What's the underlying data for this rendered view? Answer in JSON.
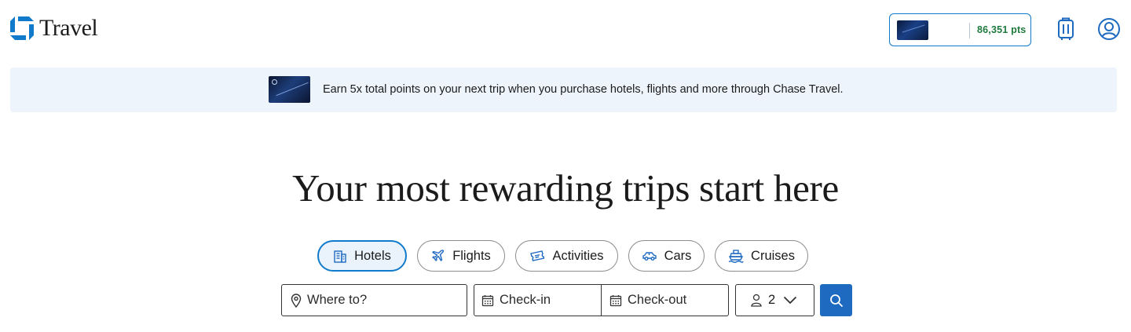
{
  "header": {
    "logo_text": "Travel",
    "points": "86,351 pts"
  },
  "banner": {
    "text": "Earn 5x total points on your next trip when you purchase hotels, flights and more through Chase Travel."
  },
  "headline": "Your most rewarding trips start here",
  "tabs": [
    {
      "label": "Hotels",
      "icon": "building-icon",
      "selected": true
    },
    {
      "label": "Flights",
      "icon": "airplane-icon",
      "selected": false
    },
    {
      "label": "Activities",
      "icon": "ticket-icon",
      "selected": false
    },
    {
      "label": "Cars",
      "icon": "car-icon",
      "selected": false
    },
    {
      "label": "Cruises",
      "icon": "ship-icon",
      "selected": false
    }
  ],
  "search": {
    "destination_placeholder": "Where to?",
    "checkin_placeholder": "Check-in",
    "checkout_placeholder": "Check-out",
    "guests": "2"
  },
  "colors": {
    "brand_blue": "#117aca",
    "search_button": "#1f6ac1",
    "banner_bg": "#edf4fb",
    "points_green": "#1f7a3d"
  }
}
